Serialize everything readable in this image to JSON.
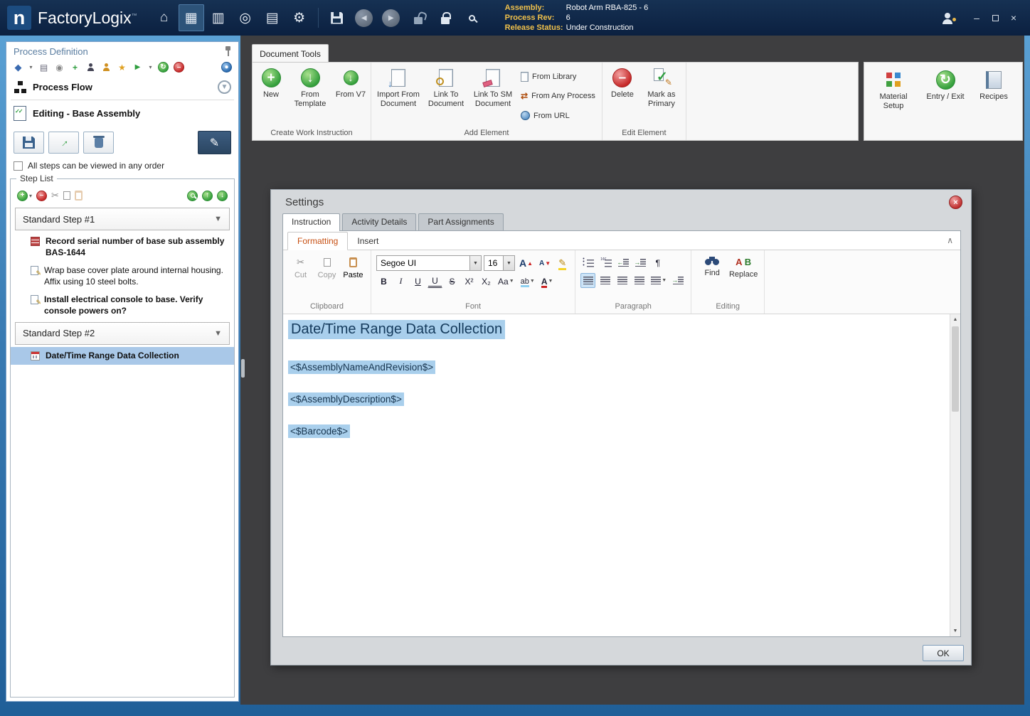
{
  "colors": {
    "titlebar": "#0c2344",
    "main_background": "#3e3e40",
    "selection_highlight": "#a9cfec",
    "formatting_tab_accent": "#c75013",
    "status_label": "#f0c14b"
  },
  "titlebar": {
    "app_name": "FactoryLogix",
    "trademark": "™",
    "info": {
      "assembly_label": "Assembly:",
      "assembly_value": "Robot Arm RBA-825 - 6",
      "process_rev_label": "Process Rev:",
      "process_rev_value": "6",
      "release_status_label": "Release Status:",
      "release_status_value": "Under Construction"
    }
  },
  "sidebar": {
    "title": "Process Definition",
    "process_flow": "Process Flow",
    "editing_title": "Editing - Base Assembly",
    "order_checkbox": "All steps can be viewed in any order",
    "step_list_title": "Step List",
    "step1": {
      "label": "Standard Step #1",
      "item1": "Record serial number of base sub assembly BAS-1644",
      "item2": "Wrap base cover plate around internal housing. Affix using 10 steel bolts.",
      "item3": "Install electrical console to base. Verify console powers on?"
    },
    "step2": {
      "label": "Standard Step #2",
      "item1": "Date/Time Range Data Collection"
    }
  },
  "ribbon": {
    "tab_label": "Document Tools",
    "create_group": {
      "label": "Create Work Instruction",
      "new": "New",
      "from_template": "From Template",
      "from_v7": "From V7"
    },
    "add_group": {
      "label": "Add Element",
      "import_from_document": "Import From Document",
      "link_to_document": "Link To Document",
      "link_to_sm_document": "Link To SM Document",
      "from_library": "From Library",
      "from_any_process": "From Any Process",
      "from_url": "From URL"
    },
    "edit_group": {
      "label": "Edit Element",
      "delete": "Delete",
      "mark_as_primary": "Mark as Primary"
    },
    "right": {
      "material_setup": "Material Setup",
      "entry_exit": "Entry / Exit",
      "recipes": "Recipes"
    }
  },
  "settings": {
    "title": "Settings",
    "tabs": {
      "instruction": "Instruction",
      "activity_details": "Activity Details",
      "part_assignments": "Part Assignments"
    },
    "editor_tabs": {
      "formatting": "Formatting",
      "insert": "Insert"
    },
    "toolbar": {
      "cut": "Cut",
      "copy": "Copy",
      "paste": "Paste",
      "clipboard_label": "Clipboard",
      "font_name": "Segoe UI",
      "font_size": "16",
      "font_label": "Font",
      "paragraph_label": "Paragraph",
      "find": "Find",
      "replace": "Replace",
      "editing_label": "Editing"
    },
    "document": {
      "heading": "Date/Time Range Data Collection",
      "token1": "<$AssemblyNameAndRevision$>",
      "token2": "<$AssemblyDescription$>",
      "token3": "<$Barcode$>"
    },
    "ok": "OK"
  },
  "icons": {
    "titlebar": [
      "home-icon",
      "work-instructions-icon",
      "process-templates-icon",
      "operations-icon",
      "documents-icon",
      "settings-gear-icon",
      "save-icon",
      "back-icon",
      "forward-icon",
      "unlock-icon",
      "lock-icon",
      "search-icon",
      "user-icon"
    ],
    "sidebar_toolbar": [
      "new-icon",
      "print-icon",
      "export-icon",
      "validate-icon",
      "audit-person-icon",
      "user-icon",
      "star-icon",
      "send-icon",
      "sync-icon",
      "remove-icon",
      "globe-icon",
      "help-icon"
    ],
    "step_toolbar": [
      "add-step-icon",
      "remove-step-icon",
      "cut-icon",
      "copy-icon",
      "paste-icon",
      "find-step-icon",
      "move-up-icon",
      "move-down-icon"
    ]
  }
}
